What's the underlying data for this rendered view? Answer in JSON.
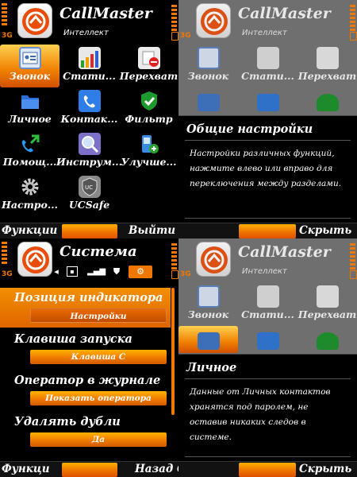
{
  "app": {
    "name": "CallMaster",
    "subtitle": "Интеллект",
    "network": "3G"
  },
  "grid_items": [
    {
      "label": "Звонок",
      "icon": "contact-card-icon"
    },
    {
      "label": "Стати...",
      "icon": "statistics-chart-icon"
    },
    {
      "label": "Перехват",
      "icon": "blocked-phone-icon"
    },
    {
      "label": "Личное",
      "icon": "folder-icon"
    },
    {
      "label": "Контак...",
      "icon": "phone-book-icon"
    },
    {
      "label": "Фильтр",
      "icon": "shield-check-icon"
    },
    {
      "label": "Помощ...",
      "icon": "call-arrow-icon"
    },
    {
      "label": "Инструм...",
      "icon": "magnifier-icon"
    },
    {
      "label": "Улучше...",
      "icon": "phone-plus-icon"
    },
    {
      "label": "Настро...",
      "icon": "gear-icon"
    },
    {
      "label": "UCSafe",
      "icon": "ucsafe-icon"
    }
  ],
  "softkeys": {
    "functions": "Функции",
    "functions_short": "Функци",
    "exit_ok": "Выйти Ок",
    "back_ok": "Назад Ок",
    "hide": "Скрыть"
  },
  "general_settings": {
    "title": "Общие настройки",
    "text": "Настройки различных функций, нажмите влево или вправо для переключения между разделами."
  },
  "system": {
    "title": "Система",
    "options": [
      {
        "label": "Позиция индикатора",
        "value": "Настройки"
      },
      {
        "label": "Клавиша запуска",
        "value": "Клавиша C"
      },
      {
        "label": "Оператор в журнале",
        "value": "Показать оператора"
      },
      {
        "label": "Удалять дубли",
        "value": "Да"
      }
    ]
  },
  "personal": {
    "title": "Личное",
    "text": "Данные от Личных контактов хранятся под паролем, не оставив никаких следов в системе."
  },
  "colors": {
    "accent": "#f07800",
    "grey_bg": "#6f6f6f"
  }
}
